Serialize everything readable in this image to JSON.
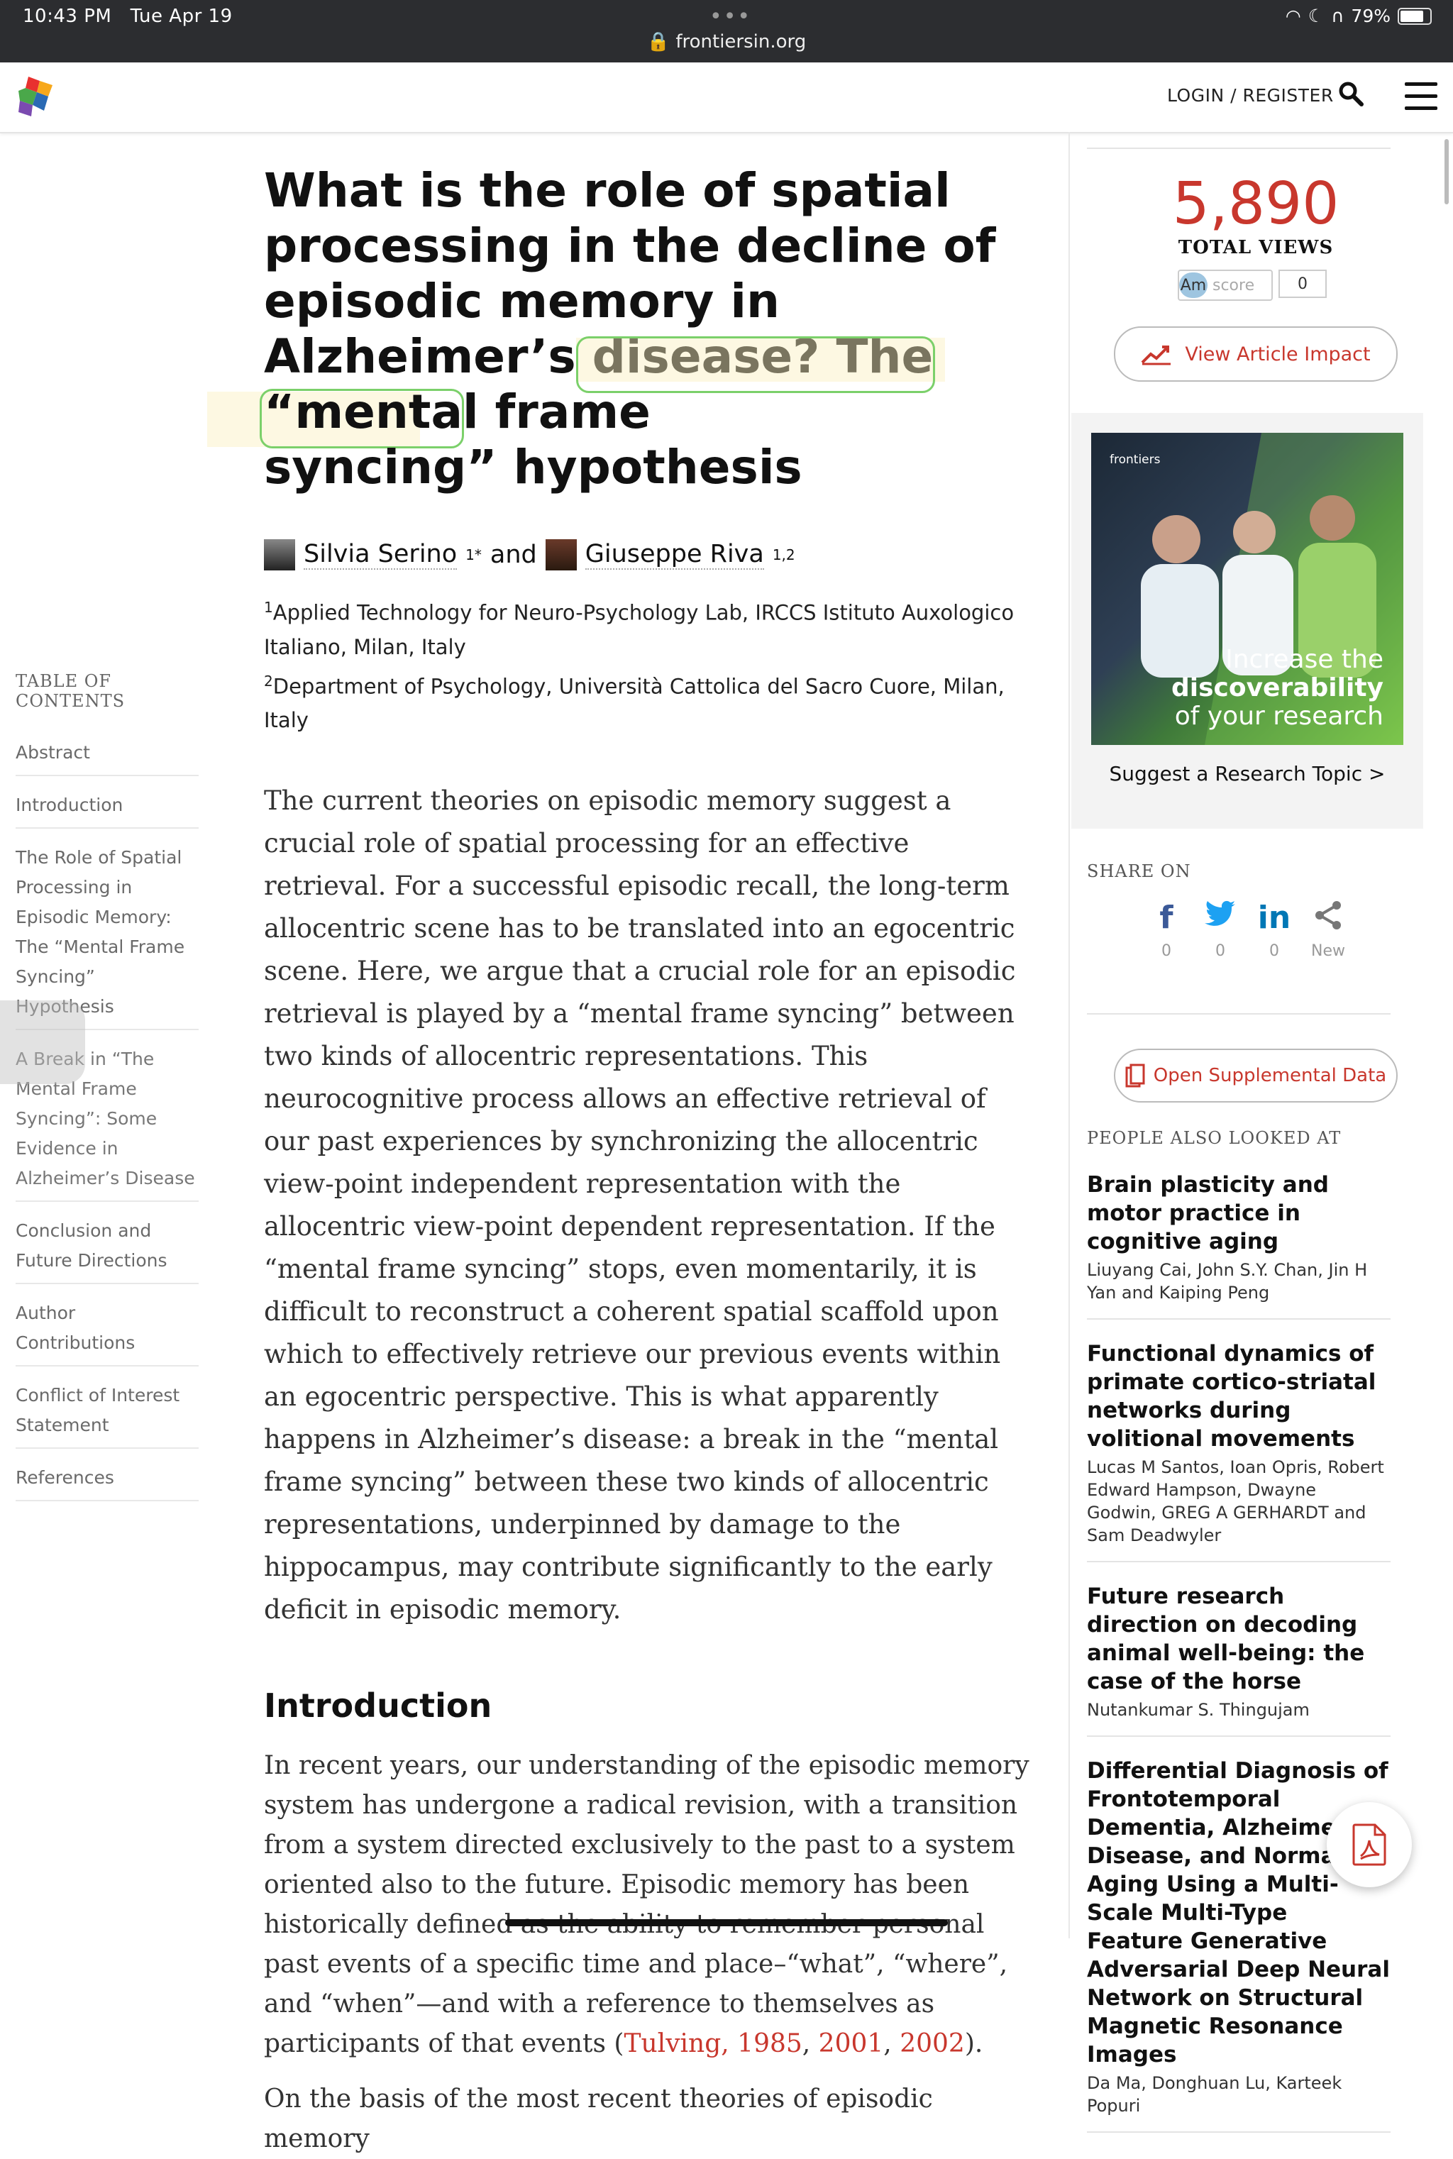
{
  "status": {
    "time": "10:43 PM",
    "date": "Tue Apr 19",
    "url": "frontiersin.org",
    "battery": "79%",
    "battery_fraction": 0.79
  },
  "nav": {
    "login": "LOGIN / REGISTER"
  },
  "article": {
    "title_part1": "What is the role of spatial processing in the decline of episodic memory in Alzheimer’s disease? The ",
    "title_highlight1": "“mental frame",
    "title_highlight2": "syncing”",
    "title_part2": " hypothesis",
    "authors": [
      {
        "name": "Silvia Serino",
        "sup": "1*"
      },
      {
        "name": "Giuseppe Riva",
        "sup": "1,2"
      }
    ],
    "and": "and",
    "affil1_sup": "1",
    "affil1": "Applied Technology for Neuro-Psychology Lab, IRCCS Istituto Auxologico Italiano, Milan, Italy",
    "affil2_sup": "2",
    "affil2": "Department of Psychology, Università Cattolica del Sacro Cuore, Milan, Italy",
    "abstract": "The current theories on episodic memory suggest a crucial role of spatial processing for an effective retrieval. For a successful episodic recall, the long-term allocentric scene has to be translated into an egocentric scene. Here, we argue that a crucial role for an episodic retrieval is played by a “mental frame syncing” between two kinds of allocentric representations. This neurocognitive process allows an effective retrieval of our past experiences by synchronizing the allocentric view-point independent representation with the allocentric view-point dependent representation. If the “mental frame syncing” stops, even momentarily, it is difficult to reconstruct a coherent spatial scaffold upon which to effectively retrieve our previous events within an egocentric perspective. This is what apparently happens in Alzheimer’s disease: a break in the “mental frame syncing” between these two kinds of allocentric representations, underpinned by damage to the hippocampus, may contribute significantly to the early deficit in episodic memory.",
    "intro_heading": "Introduction",
    "intro_text": "In recent years, our understanding of the episodic memory system has undergone a radical revision, with a transition from a system directed exclusively to the past to a system oriented also to the future. Episodic memory has been historically defined as the ability to remember personal past events of a specific time and place–“what”, “where”, and “when”—and with a reference to themselves as participants of that events (",
    "intro_refs": [
      "Tulving, 1985",
      "2001",
      "2002"
    ],
    "intro_tail": ").",
    "intro_next": "On the basis of the most recent theories of episodic memory"
  },
  "toc": {
    "title": "TABLE OF CONTENTS",
    "items": [
      "Abstract",
      "Introduction",
      "The Role of Spatial Processing in Episodic Memory: The “Mental Frame Syncing” Hypothesis",
      "A Break in “The Mental Frame Syncing”: Some Evidence in Alzheimer’s Disease",
      "Conclusion and Future Directions",
      "Author Contributions",
      "Conflict of Interest Statement",
      "References"
    ]
  },
  "sidebar": {
    "views": "5,890",
    "views_label": "TOTAL VIEWS",
    "altmetric_am": "Am",
    "altmetric_score_label": "score",
    "altmetric_score": "0",
    "impact_button": "View Article Impact",
    "ad_brand": "frontiers",
    "ad_line1": "Increase the",
    "ad_line2": "discoverability",
    "ad_line3": "of your research",
    "ad_caption": "Suggest a Research Topic >",
    "share_title": "SHARE ON",
    "share": [
      {
        "icon": "facebook-icon",
        "glyph": "f",
        "count": "0",
        "color": "#3b5998"
      },
      {
        "icon": "twitter-icon",
        "glyph": "t",
        "count": "0",
        "color": "#1da1f2"
      },
      {
        "icon": "linkedin-icon",
        "glyph": "in",
        "count": "0",
        "color": "#0077b5"
      },
      {
        "icon": "share-icon",
        "glyph": "<",
        "count": "New",
        "color": "#777777"
      }
    ],
    "supp_button": "Open Supplemental Data",
    "people_title": "PEOPLE ALSO LOOKED AT",
    "people": [
      {
        "title": "Brain plasticity and motor practice in cognitive aging",
        "authors": "Liuyang Cai, John S.Y. Chan, Jin H Yan and Kaiping Peng"
      },
      {
        "title": "Functional dynamics of primate cortico-striatal networks during volitional movements",
        "authors": "Lucas M Santos, Ioan Opris, Robert Edward Hampson, Dwayne Godwin, GREG A GERHARDT and Sam Deadwyler"
      },
      {
        "title": "Future research direction on decoding animal well-being: the case of the horse",
        "authors": "Nutankumar S. Thingujam"
      },
      {
        "title": "Differential Diagnosis of Frontotemporal Dementia, Alzheimer's Disease, and Normal Aging Using a Multi-Scale Multi-Type Feature Generative Adversarial Deep Neural Network on Structural Magnetic Resonance Images",
        "authors": "Da Ma, Donghuan Lu, Karteek Popuri"
      }
    ]
  },
  "colors": {
    "accent": "#c8372d",
    "highlight_ring": "#7bd06a"
  }
}
